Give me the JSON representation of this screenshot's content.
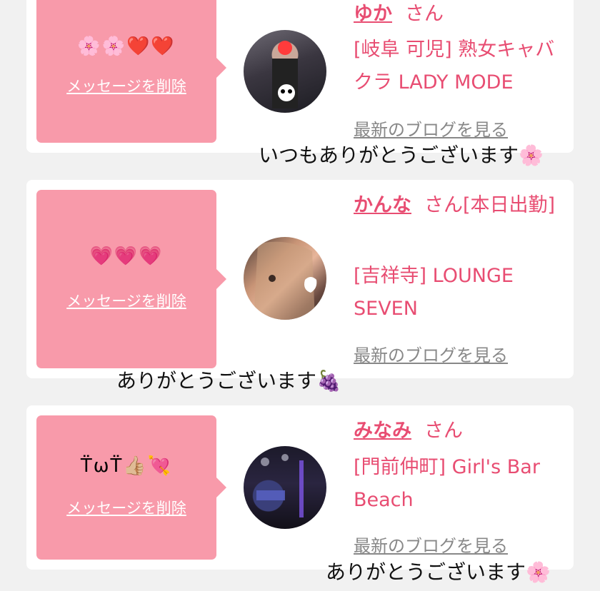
{
  "entries": [
    {
      "emoji": "🌸🌸❤️❤️",
      "delete_label": "メッセージを削除",
      "name": "ゆか",
      "honorific": "さん",
      "shop": "[岐阜 可児] 熟女キャバクラ LADY MODE",
      "blog_label": "最新のブログを見る",
      "note": "いつもありがとうございます🌸"
    },
    {
      "emoji": "💗💗💗",
      "delete_label": "メッセージを削除",
      "name": "かんな",
      "honorific": "さん[本日出勤]",
      "shop": "[吉祥寺] LOUNGE SEVEN",
      "blog_label": "最新のブログを見る",
      "note": "ありがとうございます🍇"
    },
    {
      "emoji": "T̈ωT̈👍🏼💘",
      "delete_label": "メッセージを削除",
      "name": "みなみ",
      "honorific": "さん",
      "shop": "[門前仲町] Girl's Bar Beach",
      "blog_label": "最新のブログを見る",
      "note": "ありがとうございます🌸"
    }
  ],
  "colors": {
    "bubble": "#f89aaa",
    "accent": "#e84d72",
    "background": "#f1f1f1"
  }
}
